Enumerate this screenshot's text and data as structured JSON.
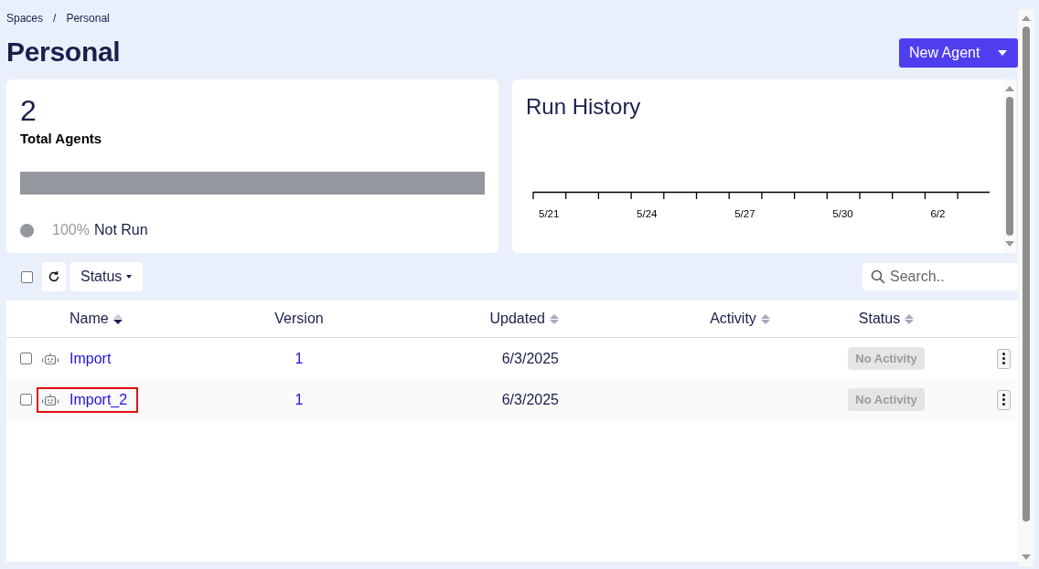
{
  "breadcrumb": {
    "items": [
      "Spaces",
      "Personal"
    ],
    "separator": "/"
  },
  "page_title": "Personal",
  "new_agent_button": {
    "label": "New Agent"
  },
  "stats_card": {
    "count": "2",
    "label": "Total Agents",
    "bar": {
      "level": 1.0,
      "color": "#94979e"
    },
    "legend": [
      {
        "percent": "100%",
        "label": "Not Run",
        "color": "#94979e"
      }
    ]
  },
  "run_history": {
    "title": "Run History",
    "axis_labels": [
      "5/21",
      "5/24",
      "5/27",
      "5/30",
      "6/2"
    ]
  },
  "toolbar": {
    "select_all_checked": false,
    "status_filter": "Status",
    "search": {
      "placeholder": "Search.."
    }
  },
  "table": {
    "columns": [
      {
        "label": "Name",
        "kind": "sortable",
        "sorted": true
      },
      {
        "label": "Version",
        "kind": "plain"
      },
      {
        "label": "Updated",
        "kind": "sortable",
        "sorted": false
      },
      {
        "label": "Activity",
        "kind": "sortable",
        "sorted": false
      },
      {
        "label": "Status",
        "kind": "sortable",
        "sorted": false
      }
    ],
    "rows": [
      {
        "name": "Import",
        "version": "1",
        "updated": "6/3/2025",
        "status": "No Activity",
        "checked": false,
        "highlighted": false
      },
      {
        "name": "Import_2",
        "version": "1",
        "updated": "6/3/2025",
        "status": "No Activity",
        "checked": false,
        "highlighted": true
      }
    ]
  }
}
